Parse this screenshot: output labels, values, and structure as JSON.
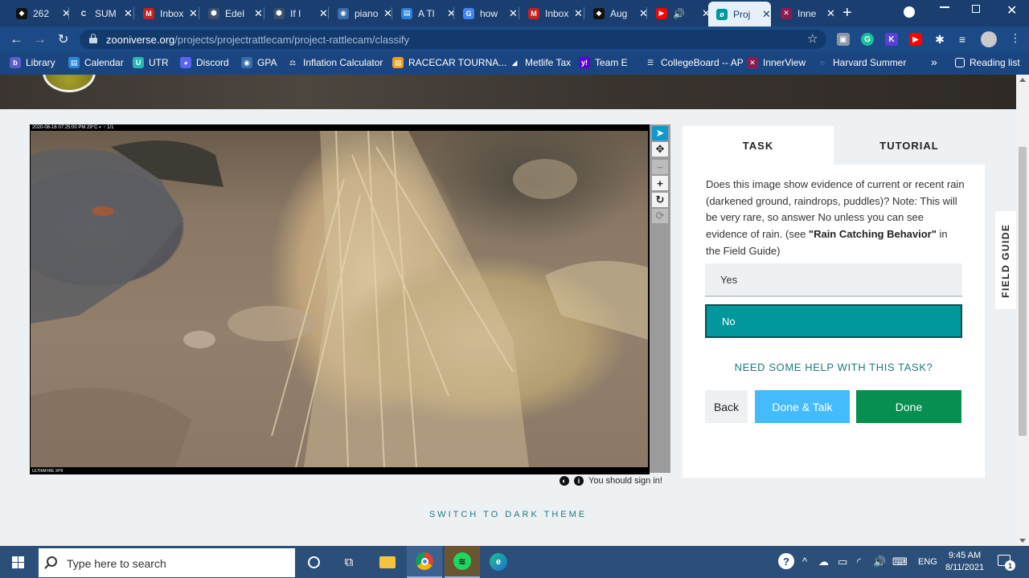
{
  "browser": {
    "tabs": [
      {
        "label": "262",
        "icon": "dark-favicon-icon",
        "color": "#111111",
        "glyph": "◆",
        "active": false
      },
      {
        "label": "SUM",
        "icon": "crescent-favicon-icon",
        "color": "#1a3e6f",
        "glyph": "C",
        "active": false
      },
      {
        "label": "Inbox",
        "icon": "gmail-icon",
        "color": "#c5221f",
        "glyph": "M",
        "active": false
      },
      {
        "label": "Edel",
        "icon": "cube-favicon-icon",
        "color": "#3a5070",
        "glyph": "⬢",
        "active": false
      },
      {
        "label": "If I",
        "icon": "cube-favicon-icon",
        "color": "#3a5070",
        "glyph": "⬢",
        "active": false
      },
      {
        "label": "piano",
        "icon": "globe-icon",
        "color": "#3b6ea8",
        "glyph": "◉",
        "active": false
      },
      {
        "label": "A Tl",
        "icon": "doc-favicon-icon",
        "color": "#2f7fd6",
        "glyph": "▤",
        "active": false
      },
      {
        "label": "how",
        "icon": "google-icon",
        "color": "#4285f4",
        "glyph": "G",
        "active": false
      },
      {
        "label": "Inbox",
        "icon": "gmail-icon",
        "color": "#c5221f",
        "glyph": "M",
        "active": false
      },
      {
        "label": "Aug",
        "icon": "dark-favicon-icon",
        "color": "#111111",
        "glyph": "◆",
        "active": false
      },
      {
        "label": "",
        "icon": "youtube-icon",
        "color": "#ff0000",
        "glyph": "▶",
        "active": false,
        "audio": "🔊"
      },
      {
        "label": "Proj",
        "icon": "zooniverse-icon",
        "color": "#00979d",
        "glyph": "ø",
        "active": true
      },
      {
        "label": "Inne",
        "icon": "innerview-icon",
        "color": "#8a1c4f",
        "glyph": "✕",
        "active": false
      }
    ],
    "url": {
      "host": "zooniverse.org",
      "path": "/projects/projectrattlecam/project-rattlecam/classify"
    },
    "bookmarks": [
      {
        "label": "Library",
        "icon": "library-icon",
        "color": "#5b5fc7",
        "glyph": "b"
      },
      {
        "label": "Calendar",
        "icon": "calendar-icon",
        "color": "#2b88d8",
        "glyph": "▤"
      },
      {
        "label": "UTR",
        "icon": "utr-icon",
        "color": "#25b7b0",
        "glyph": "U"
      },
      {
        "label": "Discord",
        "icon": "discord-icon",
        "color": "#5865f2",
        "glyph": "◕"
      },
      {
        "label": "GPA",
        "icon": "globe-icon",
        "color": "#3b6ea8",
        "glyph": "◉"
      },
      {
        "label": "Inflation Calculator",
        "icon": "scale-icon",
        "color": "#1a4580",
        "glyph": "⚖"
      },
      {
        "label": "RACECAR TOURNA...",
        "icon": "racecar-icon",
        "color": "#f29b1e",
        "glyph": "▨"
      },
      {
        "label": "Metlife Tax",
        "icon": "metlife-icon",
        "color": "#1a4580",
        "glyph": "◢"
      },
      {
        "label": "Team E",
        "icon": "yahoo-icon",
        "color": "#6001d2",
        "glyph": "y!"
      },
      {
        "label": "CollegeBoard -- AP",
        "icon": "collegeboard-icon",
        "color": "#1a4580",
        "glyph": "☰"
      },
      {
        "label": "InnerView",
        "icon": "innerview-icon",
        "color": "#8a1c4f",
        "glyph": "✕"
      },
      {
        "label": "Harvard Summer",
        "icon": "harvard-icon",
        "color": "#1a4580",
        "glyph": "◌"
      }
    ],
    "reading_list": "Reading list",
    "more_bookmarks": "»"
  },
  "subject": {
    "camera_stamp": "2020-08-16 07:25:00 PM      29°C  ◐      ↑ 1/1",
    "camera_brand": "ULTRAFIRE XP9",
    "sign_in_prompt": "You should sign in!"
  },
  "task": {
    "tabs": {
      "task": "TASK",
      "tutorial": "TUTORIAL"
    },
    "question_before": "Does this image show evidence of current or recent rain (darkened ground, raindrops, puddles)? Note: This will be very rare, so answer No unless you can see evidence of rain. (see ",
    "question_bold": "\"Rain Catching Behavior\"",
    "question_after": " in the Field Guide)",
    "answers": {
      "yes": "Yes",
      "no": "No"
    },
    "selected_answer": "No",
    "help_link": "NEED SOME HELP WITH THIS TASK?",
    "buttons": {
      "back": "Back",
      "done_talk": "Done & Talk",
      "done": "Done"
    },
    "colors": {
      "selected": "#00979d",
      "done": "#078f52",
      "done_talk": "#43bbfd"
    }
  },
  "field_guide": "FIELD GUIDE",
  "dark_theme_toggle": "SWITCH TO DARK THEME",
  "taskbar": {
    "search_placeholder": "Type here to search",
    "language": "ENG",
    "time": "9:45 AM",
    "date": "8/11/2021",
    "notification_count": "1"
  }
}
